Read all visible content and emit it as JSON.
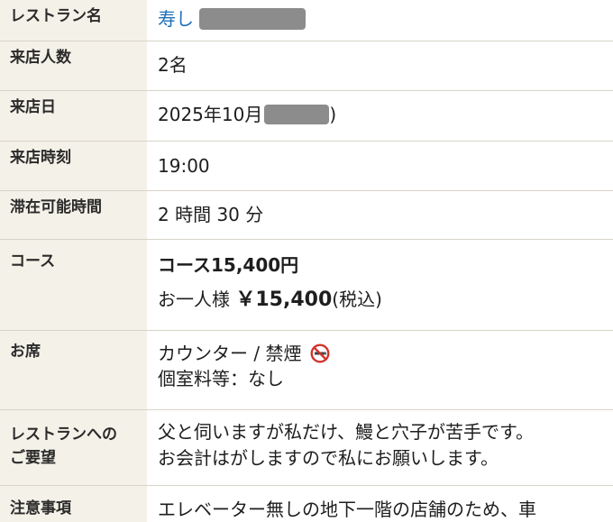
{
  "rows": {
    "restaurant": {
      "label": "レストラン名",
      "value": "寿し"
    },
    "party_size": {
      "label": "来店人数",
      "value": "2名"
    },
    "date": {
      "label": "来店日",
      "value_prefix": "2025年10月",
      "value_suffix": ")"
    },
    "time": {
      "label": "来店時刻",
      "value": "19:00"
    },
    "duration": {
      "label": "滞在可能時間",
      "value": "2 時間 30 分"
    },
    "course": {
      "label": "コース",
      "name": "コース15,400円",
      "price_prefix": "お一人様",
      "price": "￥15,400",
      "price_suffix": "(税込)"
    },
    "seat": {
      "label": "お席",
      "value": "カウンター / 禁煙",
      "icon": "no-smoking-icon",
      "private_room": "個室料等：なし"
    },
    "request": {
      "label_line1": "レストランへの",
      "label_line2": "ご要望",
      "line1": "父と伺いますが私だけ、鰻と穴子が苦手です。",
      "line2": "お会計はがしますので私にお願いします。"
    },
    "notes": {
      "label": "注意事項",
      "line1": "エレベーター無しの地下一階の店舗のため、車"
    }
  },
  "colors": {
    "label_bg": "#f4f1e8",
    "link": "#1f6fb8",
    "border": "#d8d3c6",
    "no_smoking_red": "#d0342c"
  }
}
